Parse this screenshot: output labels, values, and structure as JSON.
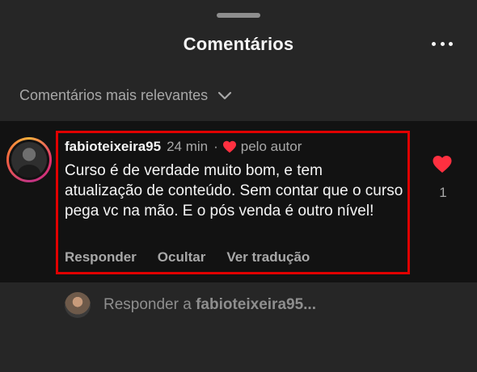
{
  "header": {
    "title": "Comentários"
  },
  "sort": {
    "label": "Comentários mais relevantes"
  },
  "comment": {
    "username": "fabioteixeira95",
    "time": "24 min",
    "separator": "·",
    "liked_by_author": "pelo autor",
    "text": "Curso é de verdade muito bom, e tem atualização de conteúdo. Sem contar que o curso pega vc na mão. E o pós venda é outro nível!",
    "actions": {
      "reply": "Responder",
      "hide": "Ocultar",
      "translate": "Ver tradução"
    },
    "like_count": "1"
  },
  "reply": {
    "prefix": "Responder a",
    "target": "fabioteixeira95..."
  },
  "colors": {
    "background": "#262626",
    "comment_bg": "#121212",
    "heart": "#ff3040",
    "highlight": "#e00000"
  }
}
